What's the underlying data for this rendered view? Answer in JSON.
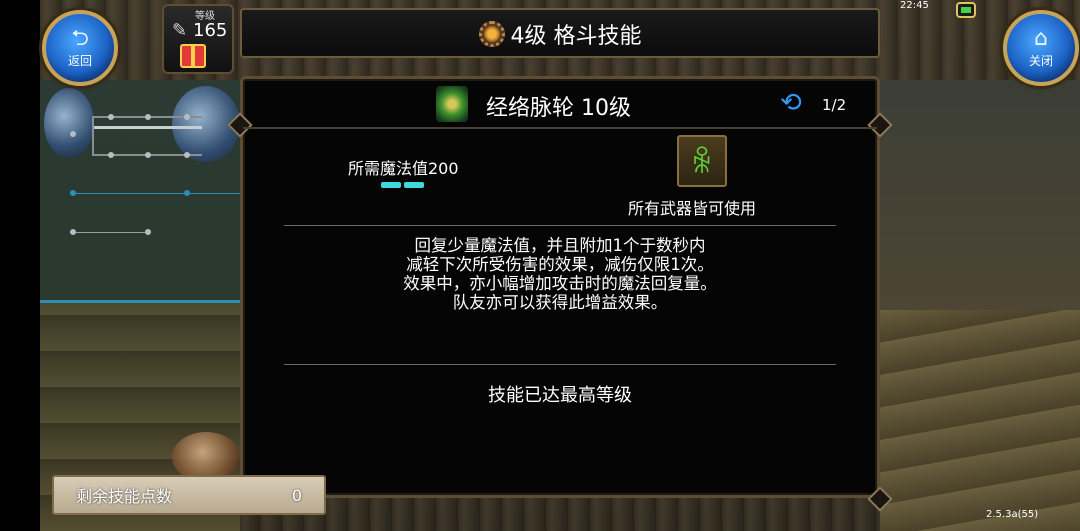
{
  "header": {
    "title": "4级 格斗技能",
    "back_label": "返回",
    "close_label": "关闭",
    "level_label": "等级",
    "level_value": "165",
    "status_time": "22:45"
  },
  "skill": {
    "name": "经络脉轮 10级",
    "page_indicator": "1/2",
    "mp_required": "所需魔法值200",
    "weapon_requirement": "所有武器皆可使用",
    "description": [
      "回复少量魔法值，并且附加1个于数秒内",
      "减轻下次所受伤害的效果，减伤仅限1次。",
      "效果中，亦小幅增加攻击时的魔法回复量。",
      "队友亦可以获得此增益效果。"
    ],
    "max_level_text": "技能已达最高等级"
  },
  "points": {
    "label": "剩余技能点数",
    "value": "0"
  },
  "footer": {
    "version": "2.5.3a(55)"
  },
  "icons": {
    "back": "back-arrow-icon",
    "close": "home-icon",
    "title": "gear-icon",
    "skill": "meditation-icon",
    "weapon": "person-icon",
    "cycle": "cycle-arrows-icon"
  },
  "colors": {
    "accent_blue": "#2e9cff",
    "mp_bar": "#3fd7e0",
    "weapon_green": "#5dd63a",
    "frame_gold": "#c6a45a"
  }
}
